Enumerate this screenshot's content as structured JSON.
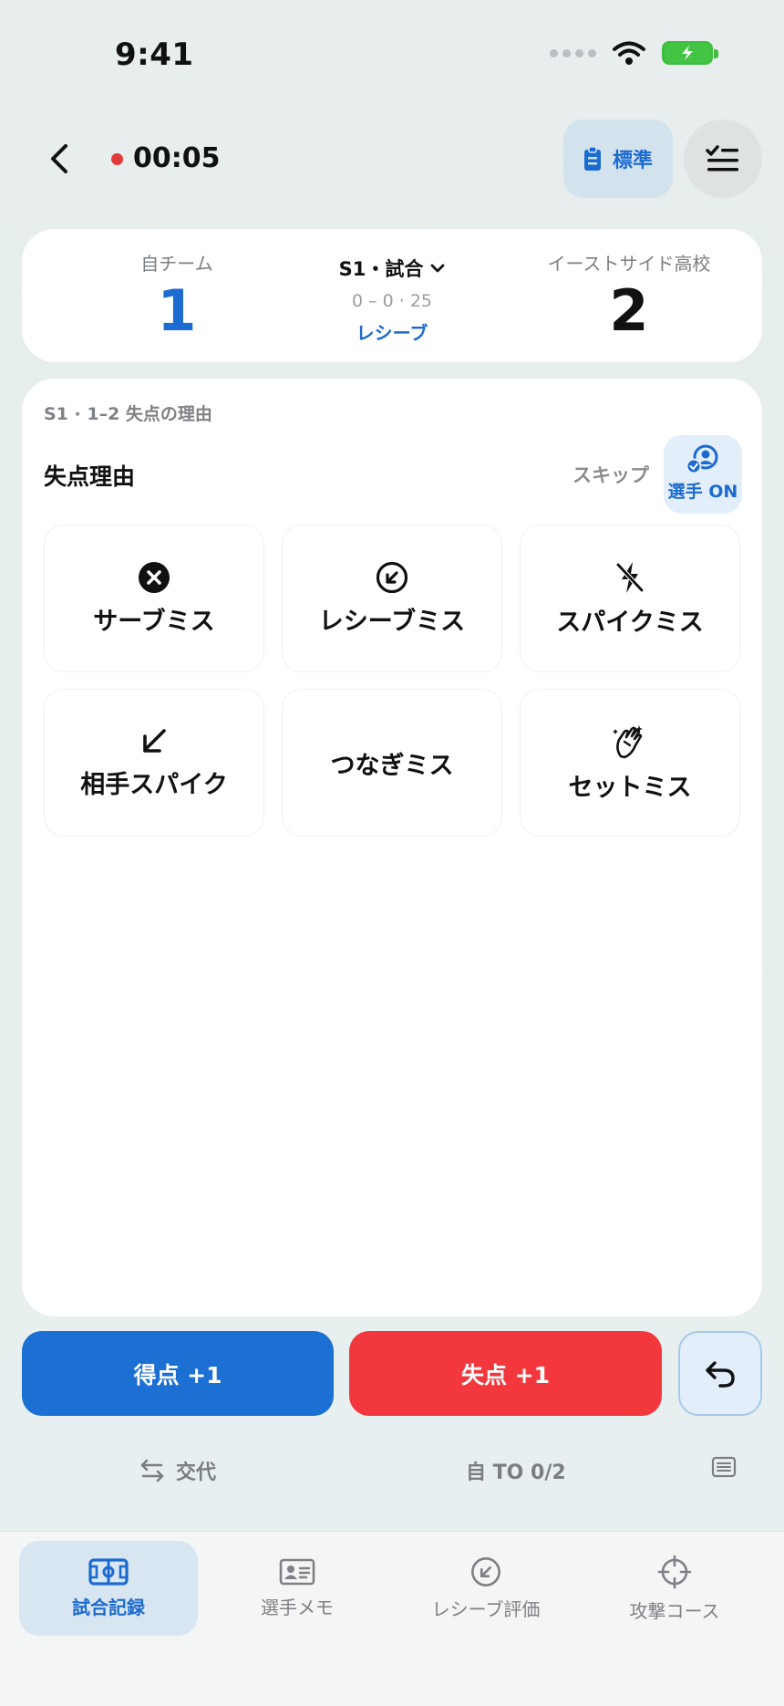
{
  "status_bar": {
    "time": "9:41"
  },
  "header": {
    "timer": "00:05",
    "standard_label": "標準"
  },
  "scoreboard": {
    "home": {
      "name": "自チーム",
      "score": "1"
    },
    "set_label": "S1・試合",
    "set_detail": "0 – 0 · 25",
    "phase": "レシーブ",
    "away": {
      "name": "イーストサイド高校",
      "score": "2"
    }
  },
  "panel": {
    "breadcrumb": "S1 · 1–2 失点の理由",
    "title": "失点理由",
    "skip_label": "スキップ",
    "player_toggle_label": "選手 ON",
    "reasons": [
      {
        "label": "サーブミス",
        "icon": "x-circle-icon"
      },
      {
        "label": "レシーブミス",
        "icon": "arrow-circle-icon"
      },
      {
        "label": "スパイクミス",
        "icon": "bolt-slash-icon"
      },
      {
        "label": "相手スパイク",
        "icon": "arrow-down-left-icon"
      },
      {
        "label": "つなぎミス",
        "icon": ""
      },
      {
        "label": "セットミス",
        "icon": "clapping-hands-icon"
      }
    ]
  },
  "actions": {
    "score_label": "得点  +1",
    "lose_label": "失点  +1",
    "substitution_label": "交代",
    "timeout_label": "自 TO 0/2"
  },
  "tabs": [
    {
      "label": "試合記録",
      "icon": "court-icon",
      "active": true
    },
    {
      "label": "選手メモ",
      "icon": "id-card-icon",
      "active": false
    },
    {
      "label": "レシーブ評価",
      "icon": "arrow-circle-icon",
      "active": false
    },
    {
      "label": "攻撃コース",
      "icon": "crosshair-icon",
      "active": false
    }
  ],
  "colors": {
    "accent": "#1c6fd3",
    "danger": "#f2383d",
    "battery": "#44c444"
  }
}
